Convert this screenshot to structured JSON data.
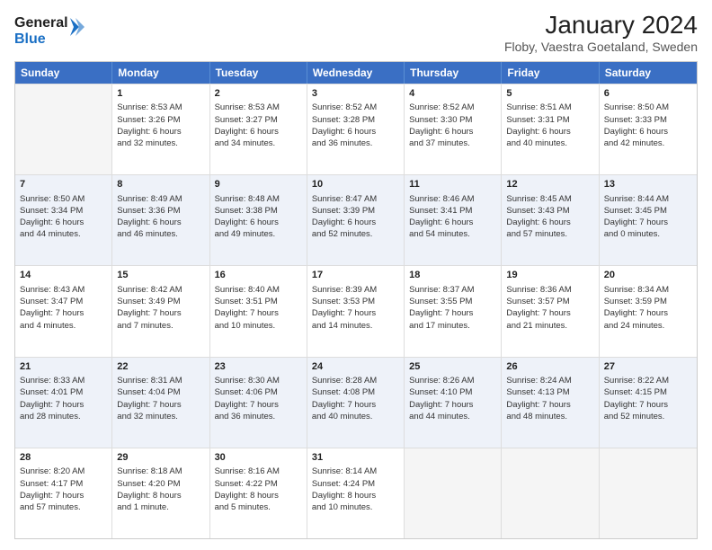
{
  "header": {
    "logo_line1": "General",
    "logo_line2": "Blue",
    "title": "January 2024",
    "subtitle": "Floby, Vaestra Goetaland, Sweden"
  },
  "weekdays": [
    "Sunday",
    "Monday",
    "Tuesday",
    "Wednesday",
    "Thursday",
    "Friday",
    "Saturday"
  ],
  "rows": [
    [
      {
        "day": "",
        "lines": []
      },
      {
        "day": "1",
        "lines": [
          "Sunrise: 8:53 AM",
          "Sunset: 3:26 PM",
          "Daylight: 6 hours",
          "and 32 minutes."
        ]
      },
      {
        "day": "2",
        "lines": [
          "Sunrise: 8:53 AM",
          "Sunset: 3:27 PM",
          "Daylight: 6 hours",
          "and 34 minutes."
        ]
      },
      {
        "day": "3",
        "lines": [
          "Sunrise: 8:52 AM",
          "Sunset: 3:28 PM",
          "Daylight: 6 hours",
          "and 36 minutes."
        ]
      },
      {
        "day": "4",
        "lines": [
          "Sunrise: 8:52 AM",
          "Sunset: 3:30 PM",
          "Daylight: 6 hours",
          "and 37 minutes."
        ]
      },
      {
        "day": "5",
        "lines": [
          "Sunrise: 8:51 AM",
          "Sunset: 3:31 PM",
          "Daylight: 6 hours",
          "and 40 minutes."
        ]
      },
      {
        "day": "6",
        "lines": [
          "Sunrise: 8:50 AM",
          "Sunset: 3:33 PM",
          "Daylight: 6 hours",
          "and 42 minutes."
        ]
      }
    ],
    [
      {
        "day": "7",
        "lines": [
          "Sunrise: 8:50 AM",
          "Sunset: 3:34 PM",
          "Daylight: 6 hours",
          "and 44 minutes."
        ]
      },
      {
        "day": "8",
        "lines": [
          "Sunrise: 8:49 AM",
          "Sunset: 3:36 PM",
          "Daylight: 6 hours",
          "and 46 minutes."
        ]
      },
      {
        "day": "9",
        "lines": [
          "Sunrise: 8:48 AM",
          "Sunset: 3:38 PM",
          "Daylight: 6 hours",
          "and 49 minutes."
        ]
      },
      {
        "day": "10",
        "lines": [
          "Sunrise: 8:47 AM",
          "Sunset: 3:39 PM",
          "Daylight: 6 hours",
          "and 52 minutes."
        ]
      },
      {
        "day": "11",
        "lines": [
          "Sunrise: 8:46 AM",
          "Sunset: 3:41 PM",
          "Daylight: 6 hours",
          "and 54 minutes."
        ]
      },
      {
        "day": "12",
        "lines": [
          "Sunrise: 8:45 AM",
          "Sunset: 3:43 PM",
          "Daylight: 6 hours",
          "and 57 minutes."
        ]
      },
      {
        "day": "13",
        "lines": [
          "Sunrise: 8:44 AM",
          "Sunset: 3:45 PM",
          "Daylight: 7 hours",
          "and 0 minutes."
        ]
      }
    ],
    [
      {
        "day": "14",
        "lines": [
          "Sunrise: 8:43 AM",
          "Sunset: 3:47 PM",
          "Daylight: 7 hours",
          "and 4 minutes."
        ]
      },
      {
        "day": "15",
        "lines": [
          "Sunrise: 8:42 AM",
          "Sunset: 3:49 PM",
          "Daylight: 7 hours",
          "and 7 minutes."
        ]
      },
      {
        "day": "16",
        "lines": [
          "Sunrise: 8:40 AM",
          "Sunset: 3:51 PM",
          "Daylight: 7 hours",
          "and 10 minutes."
        ]
      },
      {
        "day": "17",
        "lines": [
          "Sunrise: 8:39 AM",
          "Sunset: 3:53 PM",
          "Daylight: 7 hours",
          "and 14 minutes."
        ]
      },
      {
        "day": "18",
        "lines": [
          "Sunrise: 8:37 AM",
          "Sunset: 3:55 PM",
          "Daylight: 7 hours",
          "and 17 minutes."
        ]
      },
      {
        "day": "19",
        "lines": [
          "Sunrise: 8:36 AM",
          "Sunset: 3:57 PM",
          "Daylight: 7 hours",
          "and 21 minutes."
        ]
      },
      {
        "day": "20",
        "lines": [
          "Sunrise: 8:34 AM",
          "Sunset: 3:59 PM",
          "Daylight: 7 hours",
          "and 24 minutes."
        ]
      }
    ],
    [
      {
        "day": "21",
        "lines": [
          "Sunrise: 8:33 AM",
          "Sunset: 4:01 PM",
          "Daylight: 7 hours",
          "and 28 minutes."
        ]
      },
      {
        "day": "22",
        "lines": [
          "Sunrise: 8:31 AM",
          "Sunset: 4:04 PM",
          "Daylight: 7 hours",
          "and 32 minutes."
        ]
      },
      {
        "day": "23",
        "lines": [
          "Sunrise: 8:30 AM",
          "Sunset: 4:06 PM",
          "Daylight: 7 hours",
          "and 36 minutes."
        ]
      },
      {
        "day": "24",
        "lines": [
          "Sunrise: 8:28 AM",
          "Sunset: 4:08 PM",
          "Daylight: 7 hours",
          "and 40 minutes."
        ]
      },
      {
        "day": "25",
        "lines": [
          "Sunrise: 8:26 AM",
          "Sunset: 4:10 PM",
          "Daylight: 7 hours",
          "and 44 minutes."
        ]
      },
      {
        "day": "26",
        "lines": [
          "Sunrise: 8:24 AM",
          "Sunset: 4:13 PM",
          "Daylight: 7 hours",
          "and 48 minutes."
        ]
      },
      {
        "day": "27",
        "lines": [
          "Sunrise: 8:22 AM",
          "Sunset: 4:15 PM",
          "Daylight: 7 hours",
          "and 52 minutes."
        ]
      }
    ],
    [
      {
        "day": "28",
        "lines": [
          "Sunrise: 8:20 AM",
          "Sunset: 4:17 PM",
          "Daylight: 7 hours",
          "and 57 minutes."
        ]
      },
      {
        "day": "29",
        "lines": [
          "Sunrise: 8:18 AM",
          "Sunset: 4:20 PM",
          "Daylight: 8 hours",
          "and 1 minute."
        ]
      },
      {
        "day": "30",
        "lines": [
          "Sunrise: 8:16 AM",
          "Sunset: 4:22 PM",
          "Daylight: 8 hours",
          "and 5 minutes."
        ]
      },
      {
        "day": "31",
        "lines": [
          "Sunrise: 8:14 AM",
          "Sunset: 4:24 PM",
          "Daylight: 8 hours",
          "and 10 minutes."
        ]
      },
      {
        "day": "",
        "lines": []
      },
      {
        "day": "",
        "lines": []
      },
      {
        "day": "",
        "lines": []
      }
    ]
  ]
}
